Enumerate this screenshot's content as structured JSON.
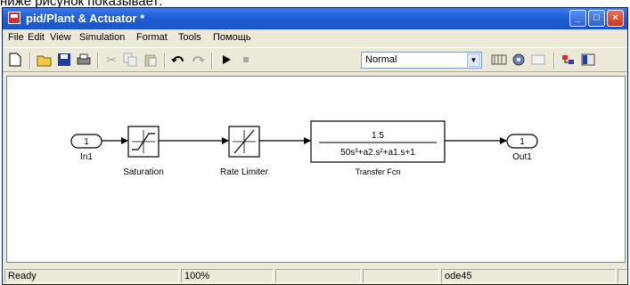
{
  "caption": "ниже рисунок показывает:",
  "window": {
    "title": "pid/Plant & Actuator *"
  },
  "menu": [
    "File",
    "Edit",
    "View",
    "Simulation",
    "Format",
    "Tools",
    "Помощь"
  ],
  "toolbar": {
    "icons": [
      "new-icon",
      "open-icon",
      "save-icon",
      "print-icon",
      "cut-icon",
      "copy-icon",
      "paste-icon",
      "undo-icon",
      "redo-icon",
      "start-icon",
      "stop-icon",
      "build-icon",
      "update-icon",
      "refresh-icon",
      "library-icon"
    ],
    "sim_mode": "Normal"
  },
  "diagram": {
    "in_port": {
      "number": "1",
      "label": "In1"
    },
    "saturation": {
      "label": "Saturation"
    },
    "rate_limiter": {
      "label": "Rate Limiter"
    },
    "transfer_fcn": {
      "numerator": "1.5",
      "denominator": "50s³+a2.s²+a1.s+1",
      "label": "Transfer Fcn"
    },
    "out_port": {
      "number": "1",
      "label": "Out1"
    }
  },
  "status": {
    "state": "Ready",
    "zoom": "100%",
    "blank1": "",
    "blank2": "",
    "solver": "ode45",
    "blank3": ""
  }
}
